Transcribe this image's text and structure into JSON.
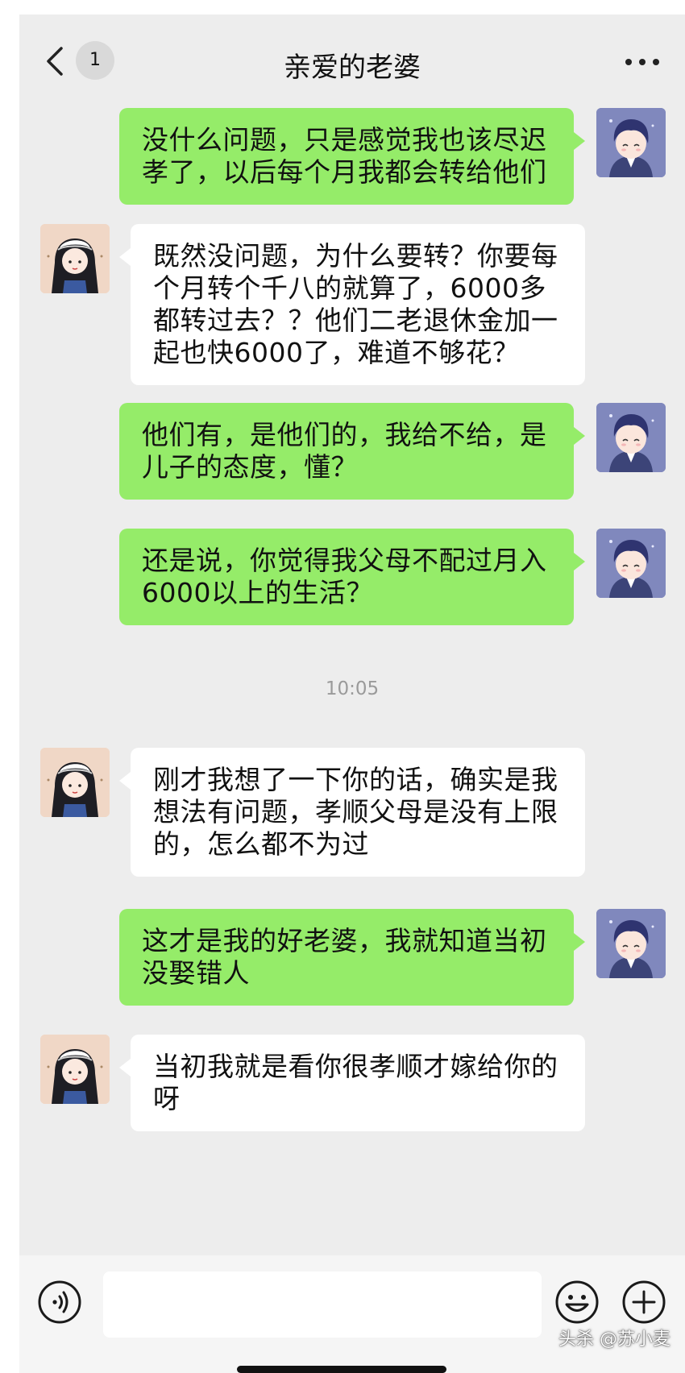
{
  "header": {
    "title": "亲爱的老婆",
    "unread_count": "1",
    "back_icon": "chevron-left-icon",
    "more_icon": "ellipsis-icon"
  },
  "messages": [
    {
      "from": "me",
      "text": "没什么问题，只是感觉我也该尽迟孝了，以后每个月我都会转给他们"
    },
    {
      "from": "her",
      "text": "既然没问题，为什么要转？你要每个月转个千八的就算了，6000多都转过去？？他们二老退休金加一起也快6000了，难道不够花？"
    },
    {
      "from": "me",
      "text": "他们有，是他们的，我给不给，是儿子的态度，懂？"
    },
    {
      "from": "me",
      "text": "还是说，你觉得我父母不配过月入6000以上的生活？"
    },
    {
      "from": "her",
      "text": "刚才我想了一下你的话，确实是我想法有问题，孝顺父母是没有上限的，怎么都不为过"
    },
    {
      "from": "me",
      "text": "这才是我的好老婆，我就知道当初没娶错人"
    },
    {
      "from": "her",
      "text": "当初我就是看你很孝顺才嫁给你的呀"
    }
  ],
  "time_divider": "10:05",
  "input_bar": {
    "voice_icon": "voice-icon",
    "emoji_icon": "emoji-icon",
    "plus_icon": "plus-icon",
    "input_value": ""
  },
  "watermark": "头杀 @苏小麦",
  "colors": {
    "my_bubble": "#95ec69",
    "her_bubble": "#ffffff",
    "background": "#ededed"
  }
}
